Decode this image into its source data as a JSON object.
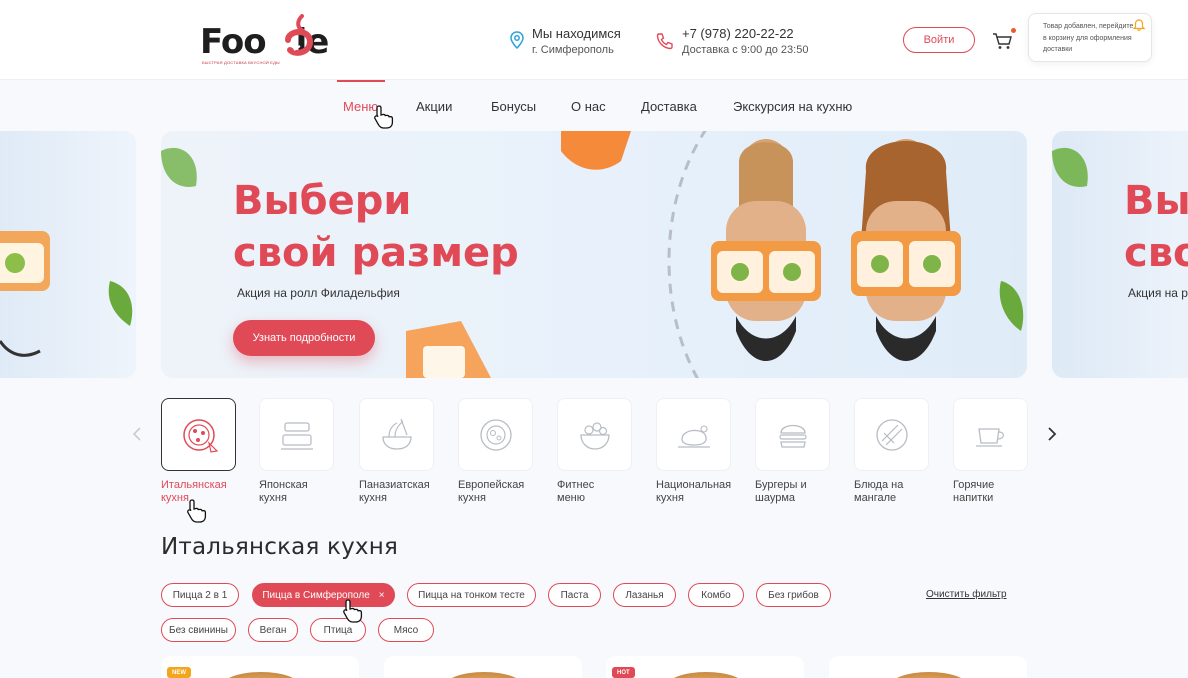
{
  "brand": {
    "name_part1": "Foo",
    "name_part2": "ie",
    "tagline": "БЫСТРАЯ ДОСТАВКА ВКУСНОЙ ЕДЫ"
  },
  "header": {
    "location_title": "Мы находимся",
    "location_city": "г. Симферополь",
    "phone": "+7 (978) 220-22-22",
    "delivery_hours": "Доставка с 9:00 до 23:50",
    "login_label": "Войти",
    "toast_text": "Товар добавлен, перейдите в корзину для оформления доставки"
  },
  "nav": {
    "items": [
      {
        "label": "Меню",
        "active": true
      },
      {
        "label": "Акции"
      },
      {
        "label": "Бонусы"
      },
      {
        "label": "О нас"
      },
      {
        "label": "Доставка"
      },
      {
        "label": "Экскурсия на кухню"
      }
    ]
  },
  "banner": {
    "title_line1": "Выбери",
    "title_line2": "свой размер",
    "subtitle": "Акция на ролл Филадельфия",
    "button_label": "Узнать подробности",
    "side_title_line1": "Выб",
    "side_title_line2": "сво",
    "side_subtitle": "Акция на р"
  },
  "categories": [
    {
      "line1": "Итальянская",
      "line2": "кухня",
      "icon": "pizza-icon",
      "active": true
    },
    {
      "line1": "Японская",
      "line2": "кухня",
      "icon": "bento-icon"
    },
    {
      "line1": "Паназиатская",
      "line2": "кухня",
      "icon": "noodles-icon"
    },
    {
      "line1": "Европейская",
      "line2": "кухня",
      "icon": "plate-icon"
    },
    {
      "line1": "Фитнес",
      "line2": "меню",
      "icon": "salad-icon"
    },
    {
      "line1": "Национальная",
      "line2": "кухня",
      "icon": "roast-icon"
    },
    {
      "line1": "Бургеры и",
      "line2": "шаурма",
      "icon": "burger-icon"
    },
    {
      "line1": "Блюда на",
      "line2": "мангале",
      "icon": "grill-icon"
    },
    {
      "line1": "Горячие",
      "line2": "напитки",
      "icon": "coffee-icon"
    }
  ],
  "section": {
    "title": "Итальянская кухня"
  },
  "filters": {
    "chips": [
      {
        "label": "Пицца 2 в 1"
      },
      {
        "label": "Пицца в Симферополе",
        "active": true
      },
      {
        "label": "Пицца на тонком тесте"
      },
      {
        "label": "Паста"
      },
      {
        "label": "Лазанья"
      },
      {
        "label": "Комбо"
      },
      {
        "label": "Без грибов"
      },
      {
        "label": "Без свинины"
      },
      {
        "label": "Веган"
      },
      {
        "label": "Птица"
      },
      {
        "label": "Мясо"
      }
    ],
    "clear_label": "Очистить фильтр"
  },
  "cards": [
    {
      "badge": "NEW",
      "badge_color": "#f3a51b"
    },
    {
      "badge": ""
    },
    {
      "badge": "HOT",
      "badge_color": "#e04a57"
    },
    {
      "badge": ""
    }
  ],
  "colors": {
    "accent": "#e04a57",
    "text": "#2b2b2b"
  }
}
